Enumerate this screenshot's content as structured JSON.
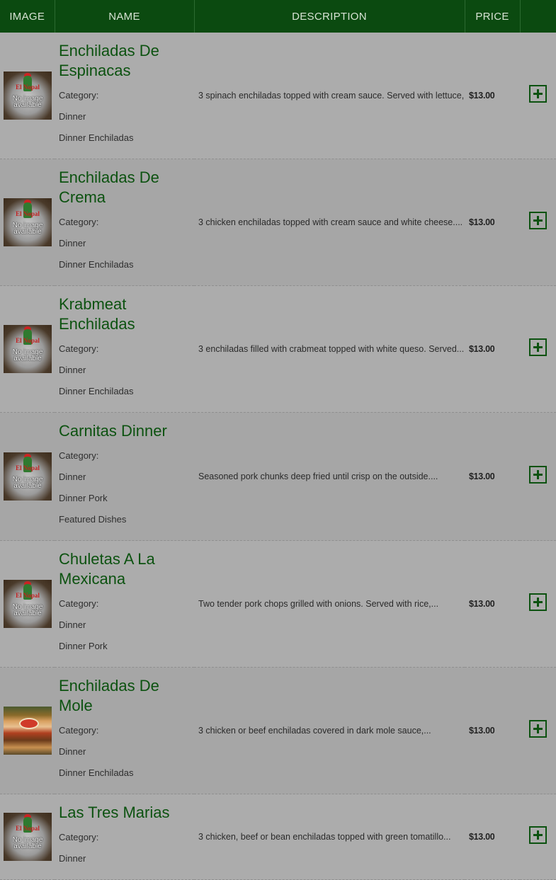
{
  "header": {
    "col_image": "IMAGE",
    "col_name": "NAME",
    "col_description": "DESCRIPTION",
    "col_price": "PRICE"
  },
  "no_image": {
    "brand": "El Nopal",
    "text": "No image available"
  },
  "category_label": "Category:",
  "add_icon": "plus-square-icon",
  "colors": {
    "header_bg": "#0b4a10",
    "accent_green": "#0c5210",
    "row_bg": "#a9a9a9"
  },
  "items": [
    {
      "name": "Enchiladas De Espinacas",
      "categories": [
        "Dinner",
        "Dinner Enchiladas"
      ],
      "description": "3 spinach enchiladas topped with cream sauce. Served with lettuce,...",
      "price": "$13.00",
      "image": "no-image"
    },
    {
      "name": "Enchiladas De Crema",
      "categories": [
        "Dinner",
        "Dinner Enchiladas"
      ],
      "description": "3 chicken enchiladas topped with cream sauce and white cheese....",
      "price": "$13.00",
      "image": "no-image"
    },
    {
      "name": "Krabmeat Enchiladas",
      "categories": [
        "Dinner",
        "Dinner Enchiladas"
      ],
      "description": "3 enchiladas filled with crabmeat topped with white queso. Served...",
      "price": "$13.00",
      "image": "no-image"
    },
    {
      "name": "Carnitas Dinner",
      "categories": [
        "Dinner",
        "Dinner Pork",
        "Featured Dishes"
      ],
      "description": "Seasoned pork chunks deep fried until crisp on the outside....",
      "price": "$13.00",
      "image": "no-image"
    },
    {
      "name": "Chuletas A La Mexicana",
      "categories": [
        "Dinner",
        "Dinner Pork"
      ],
      "description": "Two tender pork chops grilled with onions. Served with rice,...",
      "price": "$13.00",
      "image": "no-image"
    },
    {
      "name": "Enchiladas De Mole",
      "categories": [
        "Dinner",
        "Dinner Enchiladas"
      ],
      "description": "3 chicken or beef enchiladas covered in dark mole sauce,...",
      "price": "$13.00",
      "image": "photo"
    },
    {
      "name": "Las Tres Marias",
      "categories": [
        "Dinner"
      ],
      "description": "3 chicken, beef or bean enchiladas topped with green tomatillo...",
      "price": "$13.00",
      "image": "no-image"
    }
  ]
}
